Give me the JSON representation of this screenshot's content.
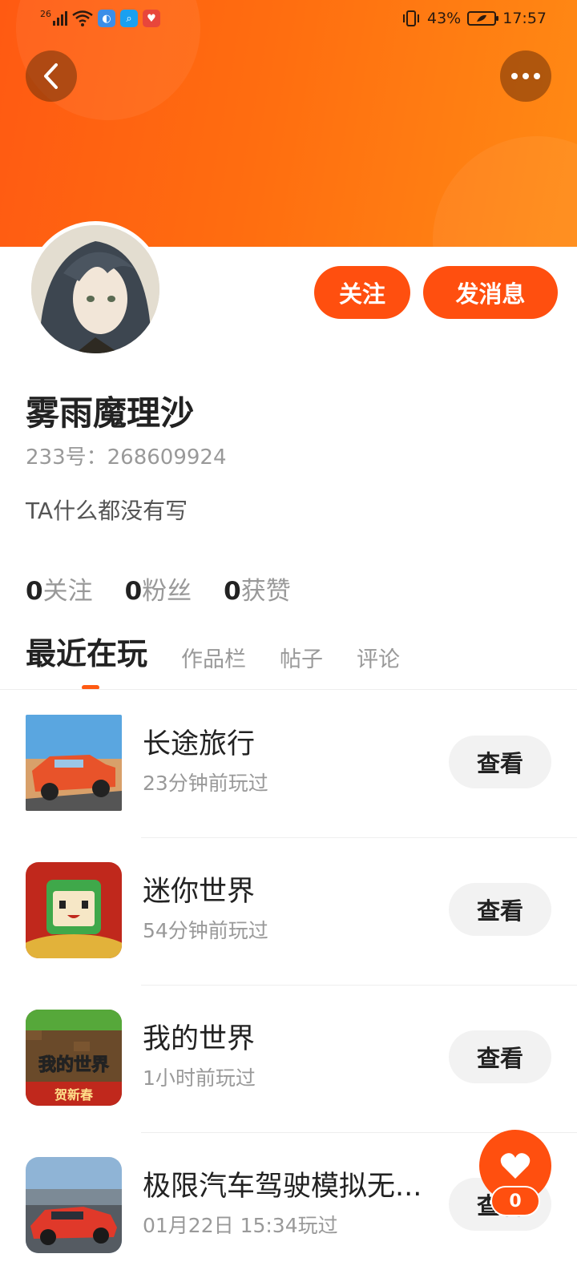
{
  "status_bar": {
    "signal_label": "26",
    "battery_percent": "43%",
    "time": "17:57",
    "icons": [
      "signal-icon",
      "wifi-icon",
      "browser-icon",
      "search-app-icon",
      "heart-app-icon",
      "vibrate-icon",
      "battery-icon"
    ]
  },
  "header": {
    "back_icon": "chevron-left-icon",
    "more_icon": "more-dots-icon"
  },
  "profile": {
    "follow_label": "关注",
    "message_label": "发消息",
    "name": "雾雨魔理沙",
    "id_text": "233号：268609924",
    "bio": "TA什么都没有写"
  },
  "stats": [
    {
      "num": "0",
      "label": "关注"
    },
    {
      "num": "0",
      "label": "粉丝"
    },
    {
      "num": "0",
      "label": "获赞"
    }
  ],
  "tabs": [
    {
      "label": "最近在玩",
      "active": true
    },
    {
      "label": "作品栏",
      "active": false
    },
    {
      "label": "帖子",
      "active": false
    },
    {
      "label": "评论",
      "active": false
    }
  ],
  "games": [
    {
      "name": "长途旅行",
      "time": "23分钟前玩过",
      "button": "查看"
    },
    {
      "name": "迷你世界",
      "time": "54分钟前玩过",
      "button": "查看"
    },
    {
      "name": "我的世界",
      "time": "1小时前玩过",
      "button": "查看",
      "thumb_text": "我的世界",
      "thumb_subtext": "贺新春"
    },
    {
      "name": "极限汽车驾驶模拟无...",
      "time": "01月22日 15:34玩过",
      "button": "查看"
    }
  ],
  "like": {
    "count": "0"
  },
  "colors": {
    "accent": "#ff4f0f",
    "header_orange": "#ff6d10"
  }
}
